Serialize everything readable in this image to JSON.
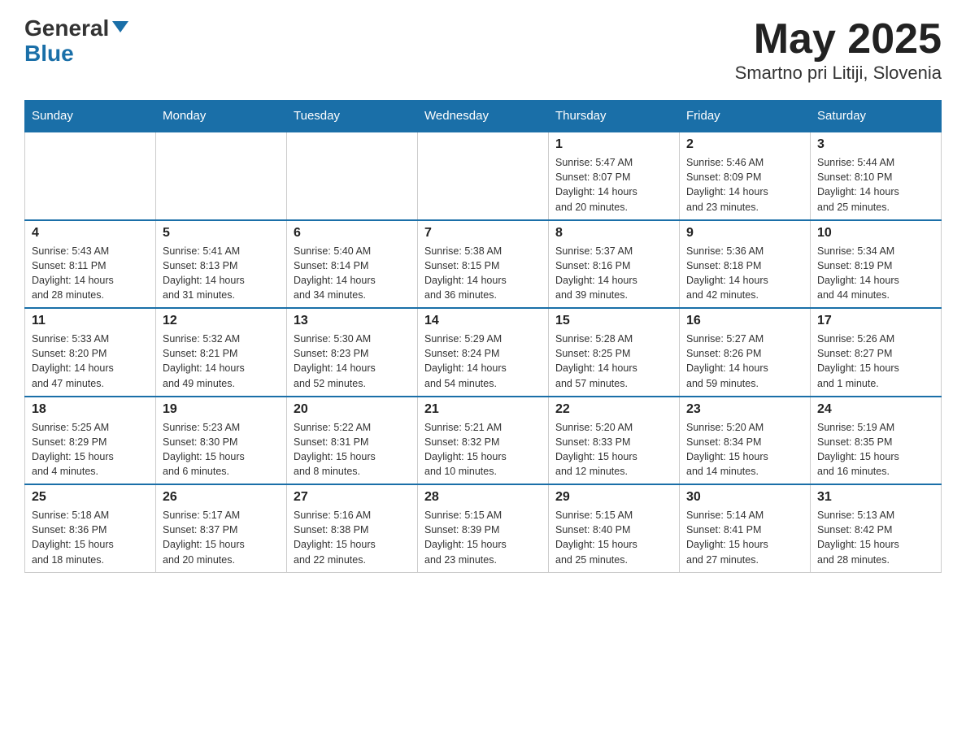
{
  "header": {
    "logo_general": "General",
    "logo_blue": "Blue",
    "title": "May 2025",
    "subtitle": "Smartno pri Litiji, Slovenia"
  },
  "days_of_week": [
    "Sunday",
    "Monday",
    "Tuesday",
    "Wednesday",
    "Thursday",
    "Friday",
    "Saturday"
  ],
  "weeks": [
    [
      {
        "day": "",
        "info": ""
      },
      {
        "day": "",
        "info": ""
      },
      {
        "day": "",
        "info": ""
      },
      {
        "day": "",
        "info": ""
      },
      {
        "day": "1",
        "info": "Sunrise: 5:47 AM\nSunset: 8:07 PM\nDaylight: 14 hours\nand 20 minutes."
      },
      {
        "day": "2",
        "info": "Sunrise: 5:46 AM\nSunset: 8:09 PM\nDaylight: 14 hours\nand 23 minutes."
      },
      {
        "day": "3",
        "info": "Sunrise: 5:44 AM\nSunset: 8:10 PM\nDaylight: 14 hours\nand 25 minutes."
      }
    ],
    [
      {
        "day": "4",
        "info": "Sunrise: 5:43 AM\nSunset: 8:11 PM\nDaylight: 14 hours\nand 28 minutes."
      },
      {
        "day": "5",
        "info": "Sunrise: 5:41 AM\nSunset: 8:13 PM\nDaylight: 14 hours\nand 31 minutes."
      },
      {
        "day": "6",
        "info": "Sunrise: 5:40 AM\nSunset: 8:14 PM\nDaylight: 14 hours\nand 34 minutes."
      },
      {
        "day": "7",
        "info": "Sunrise: 5:38 AM\nSunset: 8:15 PM\nDaylight: 14 hours\nand 36 minutes."
      },
      {
        "day": "8",
        "info": "Sunrise: 5:37 AM\nSunset: 8:16 PM\nDaylight: 14 hours\nand 39 minutes."
      },
      {
        "day": "9",
        "info": "Sunrise: 5:36 AM\nSunset: 8:18 PM\nDaylight: 14 hours\nand 42 minutes."
      },
      {
        "day": "10",
        "info": "Sunrise: 5:34 AM\nSunset: 8:19 PM\nDaylight: 14 hours\nand 44 minutes."
      }
    ],
    [
      {
        "day": "11",
        "info": "Sunrise: 5:33 AM\nSunset: 8:20 PM\nDaylight: 14 hours\nand 47 minutes."
      },
      {
        "day": "12",
        "info": "Sunrise: 5:32 AM\nSunset: 8:21 PM\nDaylight: 14 hours\nand 49 minutes."
      },
      {
        "day": "13",
        "info": "Sunrise: 5:30 AM\nSunset: 8:23 PM\nDaylight: 14 hours\nand 52 minutes."
      },
      {
        "day": "14",
        "info": "Sunrise: 5:29 AM\nSunset: 8:24 PM\nDaylight: 14 hours\nand 54 minutes."
      },
      {
        "day": "15",
        "info": "Sunrise: 5:28 AM\nSunset: 8:25 PM\nDaylight: 14 hours\nand 57 minutes."
      },
      {
        "day": "16",
        "info": "Sunrise: 5:27 AM\nSunset: 8:26 PM\nDaylight: 14 hours\nand 59 minutes."
      },
      {
        "day": "17",
        "info": "Sunrise: 5:26 AM\nSunset: 8:27 PM\nDaylight: 15 hours\nand 1 minute."
      }
    ],
    [
      {
        "day": "18",
        "info": "Sunrise: 5:25 AM\nSunset: 8:29 PM\nDaylight: 15 hours\nand 4 minutes."
      },
      {
        "day": "19",
        "info": "Sunrise: 5:23 AM\nSunset: 8:30 PM\nDaylight: 15 hours\nand 6 minutes."
      },
      {
        "day": "20",
        "info": "Sunrise: 5:22 AM\nSunset: 8:31 PM\nDaylight: 15 hours\nand 8 minutes."
      },
      {
        "day": "21",
        "info": "Sunrise: 5:21 AM\nSunset: 8:32 PM\nDaylight: 15 hours\nand 10 minutes."
      },
      {
        "day": "22",
        "info": "Sunrise: 5:20 AM\nSunset: 8:33 PM\nDaylight: 15 hours\nand 12 minutes."
      },
      {
        "day": "23",
        "info": "Sunrise: 5:20 AM\nSunset: 8:34 PM\nDaylight: 15 hours\nand 14 minutes."
      },
      {
        "day": "24",
        "info": "Sunrise: 5:19 AM\nSunset: 8:35 PM\nDaylight: 15 hours\nand 16 minutes."
      }
    ],
    [
      {
        "day": "25",
        "info": "Sunrise: 5:18 AM\nSunset: 8:36 PM\nDaylight: 15 hours\nand 18 minutes."
      },
      {
        "day": "26",
        "info": "Sunrise: 5:17 AM\nSunset: 8:37 PM\nDaylight: 15 hours\nand 20 minutes."
      },
      {
        "day": "27",
        "info": "Sunrise: 5:16 AM\nSunset: 8:38 PM\nDaylight: 15 hours\nand 22 minutes."
      },
      {
        "day": "28",
        "info": "Sunrise: 5:15 AM\nSunset: 8:39 PM\nDaylight: 15 hours\nand 23 minutes."
      },
      {
        "day": "29",
        "info": "Sunrise: 5:15 AM\nSunset: 8:40 PM\nDaylight: 15 hours\nand 25 minutes."
      },
      {
        "day": "30",
        "info": "Sunrise: 5:14 AM\nSunset: 8:41 PM\nDaylight: 15 hours\nand 27 minutes."
      },
      {
        "day": "31",
        "info": "Sunrise: 5:13 AM\nSunset: 8:42 PM\nDaylight: 15 hours\nand 28 minutes."
      }
    ]
  ]
}
